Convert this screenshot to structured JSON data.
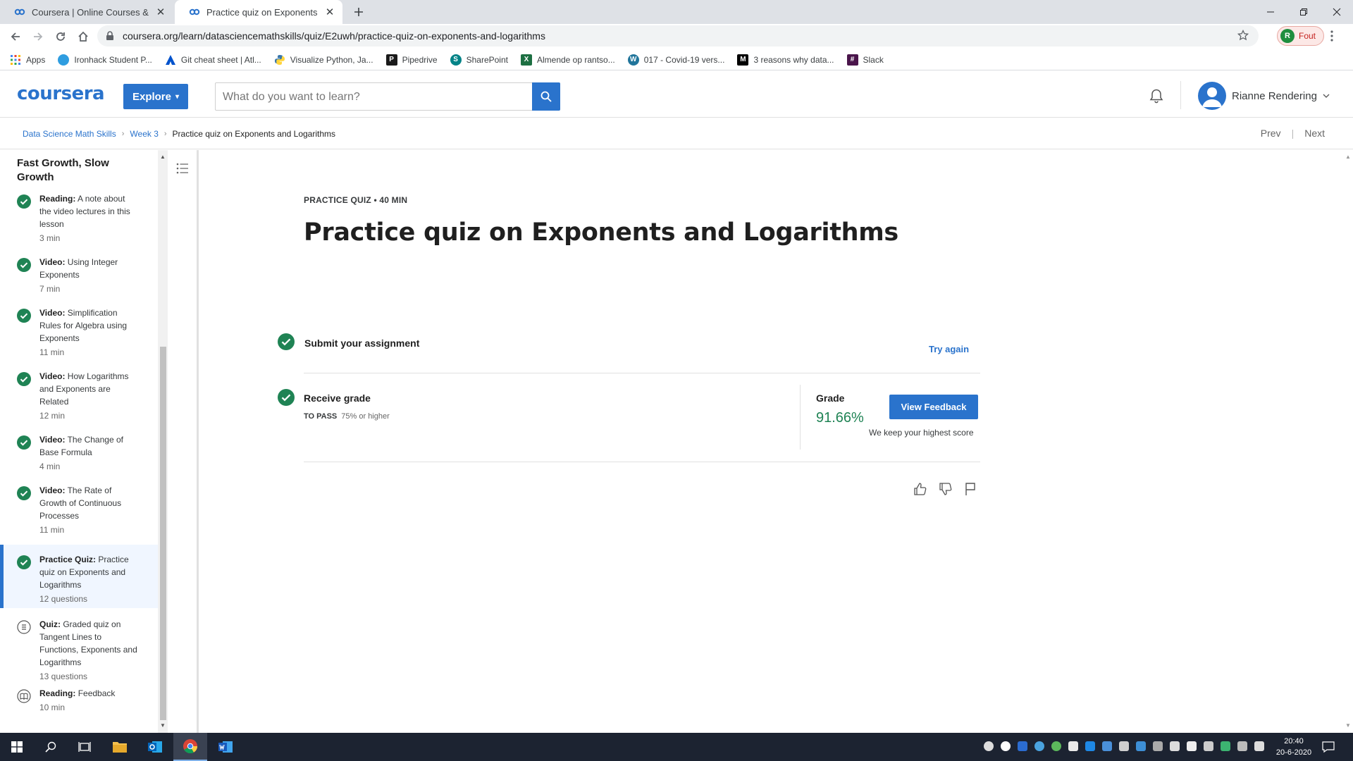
{
  "browser": {
    "tabs": [
      {
        "title": "Coursera | Online Courses & Credentials",
        "active": false
      },
      {
        "title": "Practice quiz on Exponents and Logarithms",
        "active": true
      }
    ],
    "url": "coursera.org/learn/datasciencemathskills/quiz/E2uwh/practice-quiz-on-exponents-and-logarithms",
    "profile_initial": "R",
    "profile_status": "Fout",
    "bookmarks": [
      {
        "label": "Apps",
        "icon": "apps-grid-icon",
        "color": "#4285f4"
      },
      {
        "label": "Ironhack Student P...",
        "icon": "ironhack-icon",
        "color": "#2f9de0"
      },
      {
        "label": "Git cheat sheet | Atl...",
        "icon": "atlassian-icon",
        "color": "#0052cc"
      },
      {
        "label": "Visualize Python, Ja...",
        "icon": "python-icon",
        "color": "#3776ab"
      },
      {
        "label": "Pipedrive",
        "icon": "pipedrive-icon",
        "color": "#1a1a1a"
      },
      {
        "label": "SharePoint",
        "icon": "sharepoint-icon",
        "color": "#038387"
      },
      {
        "label": "Almende op rantso...",
        "icon": "excel-icon",
        "color": "#1d6f42"
      },
      {
        "label": "017 - Covid-19 vers...",
        "icon": "wordpress-icon",
        "color": "#21759b"
      },
      {
        "label": "3 reasons why data...",
        "icon": "medium-icon",
        "color": "#000000"
      },
      {
        "label": "Slack",
        "icon": "slack-icon",
        "color": "#4a154b"
      }
    ]
  },
  "header": {
    "logo": "coursera",
    "explore_label": "Explore",
    "search_placeholder": "What do you want to learn?",
    "user_name": "Rianne Rendering"
  },
  "breadcrumb": {
    "course": "Data Science Math Skills",
    "week": "Week 3",
    "current": "Practice quiz on Exponents and Logarithms",
    "prev_label": "Prev",
    "next_label": "Next"
  },
  "sidebar": {
    "heading": "Fast Growth, Slow Growth",
    "items": [
      {
        "kind": "Reading:",
        "title": "A note about the video lectures in this lesson",
        "duration": "3 min",
        "status": "done"
      },
      {
        "kind": "Video:",
        "title": "Using Integer Exponents",
        "duration": "7 min",
        "status": "done"
      },
      {
        "kind": "Video:",
        "title": "Simplification Rules for Algebra using Exponents",
        "duration": "11 min",
        "status": "done"
      },
      {
        "kind": "Video:",
        "title": "How Logarithms and Exponents are Related",
        "duration": "12 min",
        "status": "done"
      },
      {
        "kind": "Video:",
        "title": "The Change of Base Formula",
        "duration": "4 min",
        "status": "done"
      },
      {
        "kind": "Video:",
        "title": "The Rate of Growth of Continuous Processes",
        "duration": "11 min",
        "status": "done"
      },
      {
        "kind": "Practice Quiz:",
        "title": "Practice quiz on Exponents and Logarithms",
        "duration": "12 questions",
        "status": "done"
      },
      {
        "kind": "Quiz:",
        "title": "Graded quiz on Tangent Lines to Functions, Exponents and Logarithms",
        "duration": "13 questions",
        "status": "quiz"
      },
      {
        "kind": "Reading:",
        "title": "Feedback",
        "duration": "10 min",
        "status": "reading"
      }
    ]
  },
  "main": {
    "meta": "PRACTICE QUIZ • 40 MIN",
    "title": "Practice quiz on Exponents and Logarithms",
    "submit_label": "Submit your assignment",
    "try_again_label": "Try again",
    "receive_label": "Receive grade",
    "to_pass_label": "TO PASS",
    "to_pass_value": "75% or higher",
    "grade_label": "Grade",
    "grade_value": "91.66%",
    "feedback_button": "View Feedback",
    "keep_note": "We keep your highest score"
  },
  "taskbar": {
    "time": "20:40",
    "date": "20-6-2020"
  },
  "colors": {
    "brand": "#2a73cc",
    "success": "#1f8354"
  }
}
